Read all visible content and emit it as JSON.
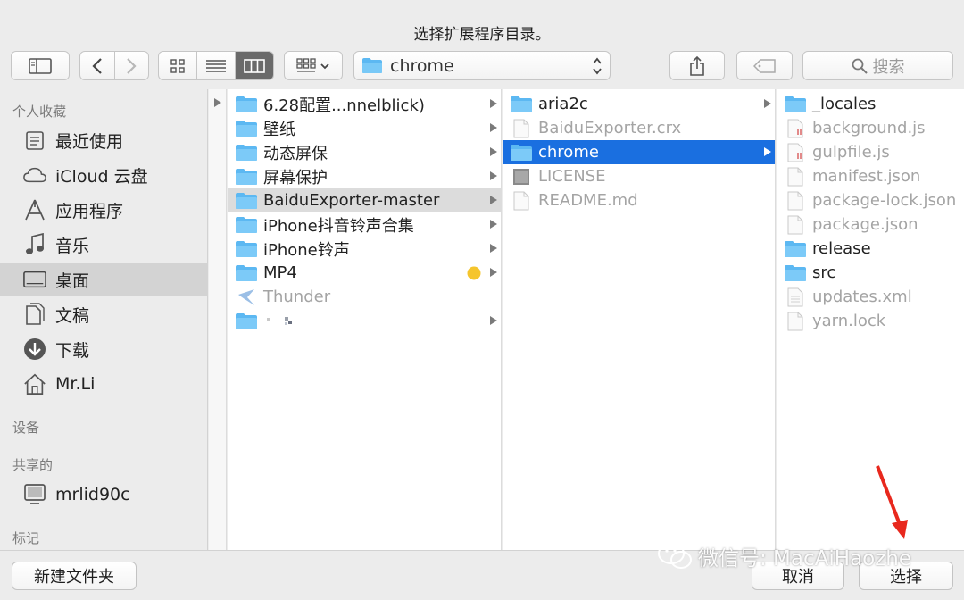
{
  "window": {
    "title": "选择扩展程序目录。"
  },
  "toolbar": {
    "path_popup": "chrome",
    "search_placeholder": "搜索"
  },
  "sidebar": {
    "favorites_header": "个人收藏",
    "favorites": [
      {
        "label": "最近使用",
        "icon": "recents-icon",
        "selected": false
      },
      {
        "label": "iCloud 云盘",
        "icon": "icloud-icon",
        "selected": false
      },
      {
        "label": "应用程序",
        "icon": "applications-icon",
        "selected": false
      },
      {
        "label": "音乐",
        "icon": "music-icon",
        "selected": false
      },
      {
        "label": "桌面",
        "icon": "desktop-icon",
        "selected": true
      },
      {
        "label": "文稿",
        "icon": "documents-icon",
        "selected": false
      },
      {
        "label": "下载",
        "icon": "downloads-icon",
        "selected": false
      },
      {
        "label": "Mr.Li",
        "icon": "home-icon",
        "selected": false
      }
    ],
    "devices_header": "设备",
    "shared_header": "共享的",
    "shared": [
      {
        "label": "mrlid90c",
        "icon": "computer-icon"
      }
    ],
    "tags_header": "标记"
  },
  "columns": [
    {
      "items": [
        {
          "name": "6.28配置...nnelblick)",
          "kind": "folder",
          "chevron": true
        },
        {
          "name": "壁纸",
          "kind": "folder",
          "chevron": true
        },
        {
          "name": "动态屏保",
          "kind": "folder",
          "chevron": true
        },
        {
          "name": "屏幕保护",
          "kind": "folder",
          "chevron": true
        },
        {
          "name": "BaiduExporter-master",
          "kind": "folder",
          "chevron": true,
          "highlight": "gray"
        },
        {
          "name": "iPhone抖音铃声合集",
          "kind": "folder",
          "chevron": true
        },
        {
          "name": "iPhone铃声",
          "kind": "folder",
          "chevron": true
        },
        {
          "name": "MP4",
          "kind": "folder",
          "chevron": true,
          "tag_color": "#f5c52c"
        },
        {
          "name": "Thunder",
          "kind": "app",
          "chevron": false,
          "dim": true
        },
        {
          "name": "",
          "kind": "folder",
          "chevron": true
        }
      ]
    },
    {
      "items": [
        {
          "name": "aria2c",
          "kind": "folder",
          "chevron": true
        },
        {
          "name": "BaiduExporter.crx",
          "kind": "file",
          "dim": true
        },
        {
          "name": "chrome",
          "kind": "folder",
          "chevron": true,
          "highlight": "blue"
        },
        {
          "name": "LICENSE",
          "kind": "file-dark",
          "dim": true
        },
        {
          "name": "README.md",
          "kind": "file",
          "dim": true
        }
      ]
    },
    {
      "items": [
        {
          "name": "_locales",
          "kind": "folder"
        },
        {
          "name": "background.js",
          "kind": "jsfile",
          "dim": true
        },
        {
          "name": "gulpfile.js",
          "kind": "jsfile",
          "dim": true
        },
        {
          "name": "manifest.json",
          "kind": "file",
          "dim": true
        },
        {
          "name": "package-lock.json",
          "kind": "file",
          "dim": true
        },
        {
          "name": "package.json",
          "kind": "file",
          "dim": true
        },
        {
          "name": "release",
          "kind": "folder"
        },
        {
          "name": "src",
          "kind": "folder"
        },
        {
          "name": "updates.xml",
          "kind": "file",
          "dim": true
        },
        {
          "name": "yarn.lock",
          "kind": "file",
          "dim": true
        }
      ]
    }
  ],
  "bottom": {
    "new_folder": "新建文件夹",
    "cancel": "取消",
    "choose": "选择"
  },
  "watermark": "微信号: MacAiHaozhe",
  "colors": {
    "accent": "#1a6fe0",
    "folder": "#5cb8f2",
    "arrow": "#e8281d"
  }
}
